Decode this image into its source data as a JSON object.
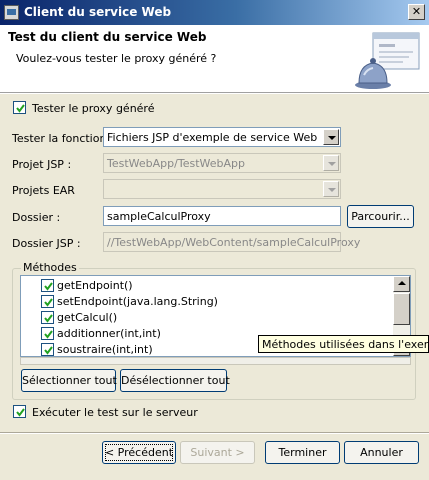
{
  "window": {
    "title": "Client du service Web",
    "close_glyph": "✕"
  },
  "header": {
    "title": "Test du client du service Web",
    "subtitle": "Voulez-vous tester le proxy généré ?",
    "icon": "webservice-bell-banner-icon"
  },
  "test_proxy": {
    "label": "Tester le proxy généré",
    "checked": true
  },
  "form": {
    "function": {
      "label": "Tester la fonction",
      "value": "Fichiers JSP d'exemple de service Web"
    },
    "jsp_project": {
      "label": "Projet JSP :",
      "value": "TestWebApp/TestWebApp"
    },
    "ear_projects": {
      "label": "Projets EAR",
      "value": ""
    },
    "folder": {
      "label": "Dossier :",
      "value": "sampleCalculProxy",
      "browse_label": "Parcourir..."
    },
    "jsp_folder": {
      "label": "Dossier JSP :",
      "value": "//TestWebApp/WebContent/sampleCalculProxy"
    }
  },
  "methods": {
    "legend": "Méthodes",
    "items": [
      {
        "label": "getEndpoint()",
        "checked": true
      },
      {
        "label": "setEndpoint(java.lang.String)",
        "checked": true
      },
      {
        "label": "getCalcul()",
        "checked": true
      },
      {
        "label": "additionner(int,int)",
        "checked": true
      },
      {
        "label": "soustraire(int,int)",
        "checked": true
      }
    ],
    "select_all_label": "Sélectionner tout",
    "deselect_all_label": "Désélectionner tout",
    "tooltip": "Méthodes utilisées dans l'exemple."
  },
  "run_on_server": {
    "label": "Exécuter le test sur le serveur",
    "checked": true
  },
  "buttons": {
    "back": "< Précédent",
    "next": "Suivant >",
    "finish": "Terminer",
    "cancel": "Annuler"
  }
}
